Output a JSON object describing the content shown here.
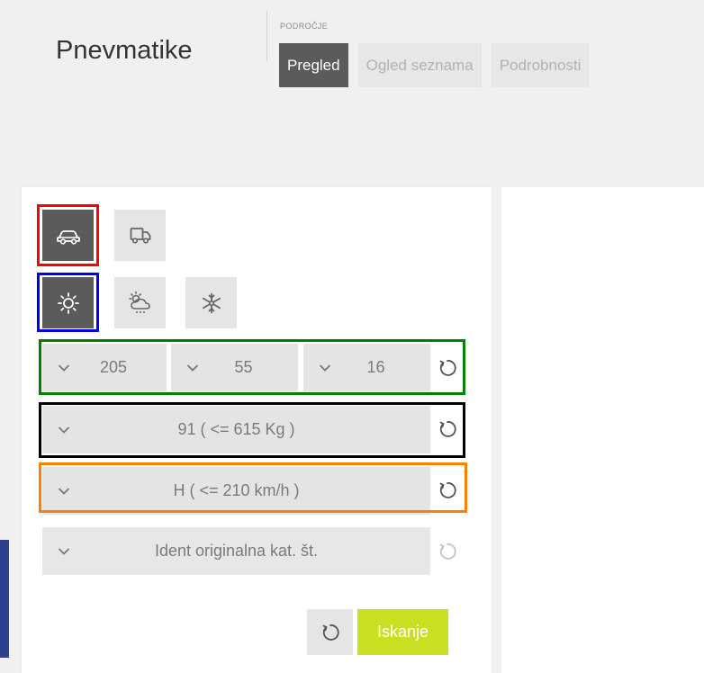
{
  "header": {
    "title": "Pnevmatike",
    "area_label": "PODROČJE",
    "tabs": [
      {
        "label": "Pregled",
        "active": true
      },
      {
        "label": "Ogled seznama",
        "active": false
      },
      {
        "label": "Podrobnosti",
        "active": false
      }
    ]
  },
  "vehicle_types": [
    {
      "icon": "car-icon",
      "selected": true
    },
    {
      "icon": "truck-icon",
      "selected": false
    }
  ],
  "seasons": [
    {
      "icon": "sun-icon",
      "selected": true
    },
    {
      "icon": "all-season-icon",
      "selected": false
    },
    {
      "icon": "snowflake-icon",
      "selected": false
    }
  ],
  "dimensions": {
    "width": "205",
    "ratio": "55",
    "diameter": "16"
  },
  "load_index": "91 ( <= 615 Kg )",
  "speed_index": "H ( <= 210 km/h )",
  "ident": {
    "placeholder": "Ident originalna kat. št."
  },
  "actions": {
    "search_label": "Iskanje"
  },
  "colors": {
    "active_button": "#5b5b5b",
    "search_button": "#c8e021",
    "highlight_red": "#ff0000",
    "highlight_blue": "#0000ee",
    "highlight_green": "#008000",
    "highlight_black": "#000000",
    "highlight_orange": "#ff8000"
  }
}
